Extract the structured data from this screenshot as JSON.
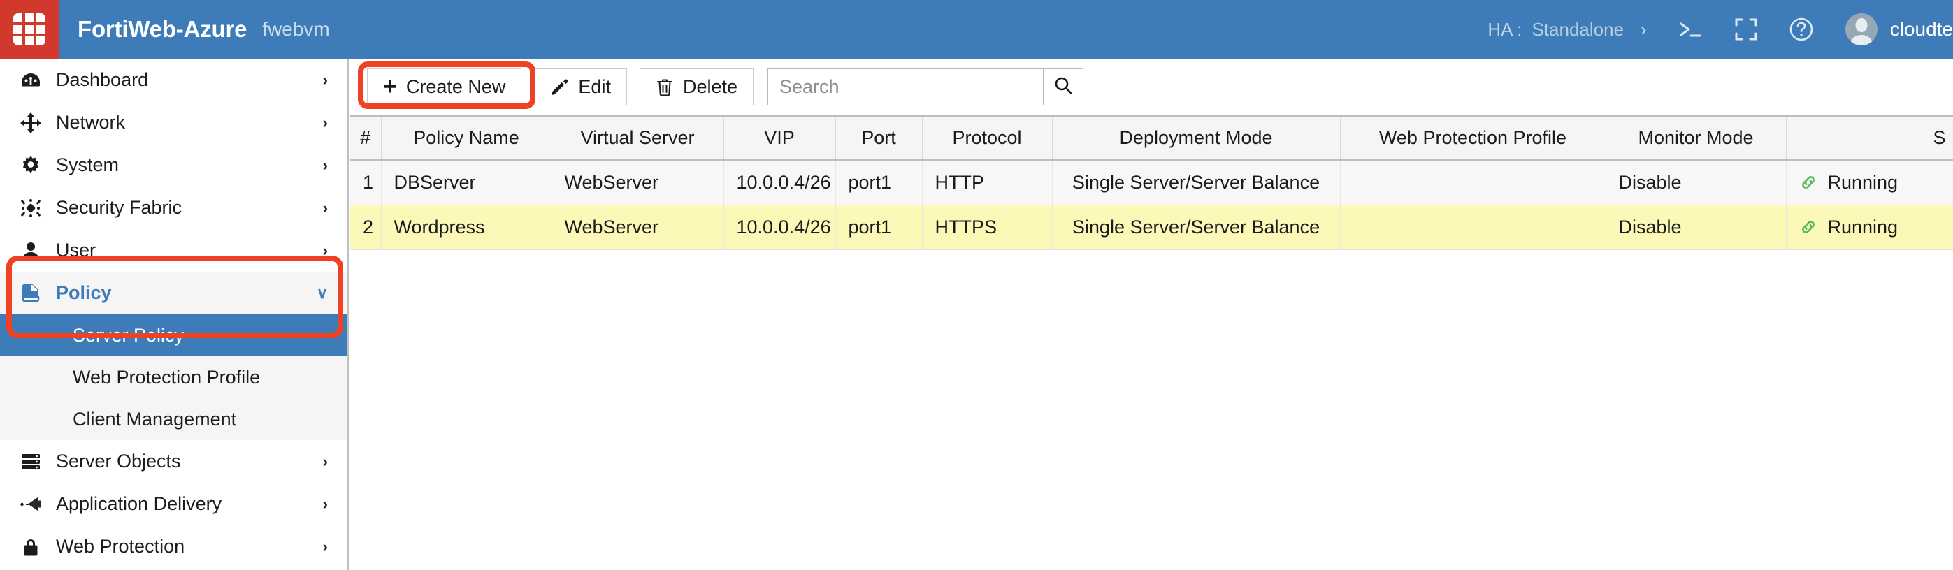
{
  "header": {
    "logo_icon": "fortinet-logo-icon",
    "product": "FortiWeb-Azure",
    "hostname": "fwebvm",
    "ha_label": "HA :",
    "ha_value": "Standalone",
    "ha_chevron": "›",
    "cli_icon": "cli-console-icon",
    "fullscreen_icon": "fullscreen-icon",
    "help_icon": "help-icon",
    "avatar_icon": "user-avatar-icon",
    "user": "cloudte",
    "bg_color": "#3d7cb8",
    "logo_color": "#d1392c"
  },
  "sidebar": {
    "items": [
      {
        "label": "Dashboard",
        "icon": "dashboard-icon",
        "chevron": "›"
      },
      {
        "label": "Network",
        "icon": "network-icon",
        "chevron": "›"
      },
      {
        "label": "System",
        "icon": "gear-icon",
        "chevron": "›"
      },
      {
        "label": "Security Fabric",
        "icon": "security-fabric-icon",
        "chevron": "›"
      },
      {
        "label": "User",
        "icon": "user-icon",
        "chevron": "›"
      },
      {
        "label": "Policy",
        "icon": "policy-icon",
        "chevron": "∨"
      },
      {
        "label": "Server Objects",
        "icon": "server-objects-icon",
        "chevron": "›"
      },
      {
        "label": "Application Delivery",
        "icon": "application-delivery-icon",
        "chevron": "›"
      },
      {
        "label": "Web Protection",
        "icon": "lock-icon",
        "chevron": "›"
      }
    ],
    "policy_submenu": [
      {
        "label": "Server Policy",
        "active": true
      },
      {
        "label": "Web Protection Profile",
        "active": false
      },
      {
        "label": "Client Management",
        "active": false
      }
    ],
    "active_color": "#3d7cb8",
    "annotation_color": "#ef4123"
  },
  "toolbar": {
    "create_label": "Create New",
    "create_icon": "plus-icon",
    "edit_label": "Edit",
    "edit_icon": "pencil-icon",
    "delete_label": "Delete",
    "delete_icon": "trash-icon",
    "search_value": "",
    "search_placeholder": "Search",
    "search_icon": "search-icon"
  },
  "table": {
    "columns": [
      "#",
      "Policy Name",
      "Virtual Server",
      "VIP",
      "Port",
      "Protocol",
      "Deployment Mode",
      "Web Protection Profile",
      "Monitor Mode",
      "S"
    ],
    "rows": [
      {
        "num": "1",
        "policy_name": "DBServer",
        "virtual_server": "WebServer",
        "vip": "10.0.0.4/26",
        "port": "port1",
        "protocol": "HTTP",
        "deployment_mode": "Single Server/Server Balance",
        "web_protection_profile": "",
        "monitor_mode": "Disable",
        "status": "Running",
        "status_icon": "chain-link-icon",
        "selected": false
      },
      {
        "num": "2",
        "policy_name": "Wordpress",
        "virtual_server": "WebServer",
        "vip": "10.0.0.4/26",
        "port": "port1",
        "protocol": "HTTPS",
        "deployment_mode": "Single Server/Server Balance",
        "web_protection_profile": "",
        "monitor_mode": "Disable",
        "status": "Running",
        "status_icon": "chain-link-icon",
        "selected": true
      }
    ],
    "selected_row_color": "#fbf8b8",
    "status_icon_color": "#5cb85c"
  }
}
